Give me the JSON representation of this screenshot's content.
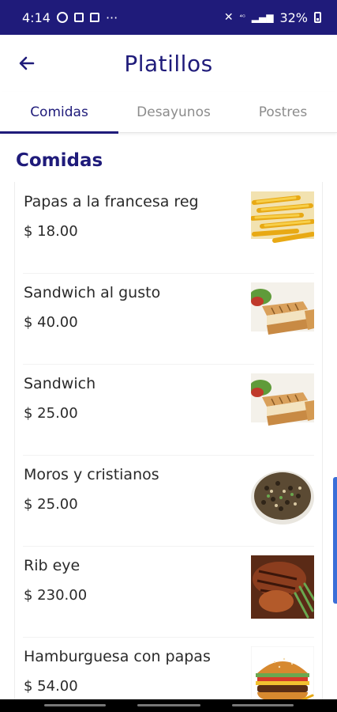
{
  "status_bar": {
    "time": "4:14",
    "battery": "32%",
    "overflow": "···",
    "icons": [
      "whatsapp-icon",
      "image-icon",
      "message-icon",
      "mute-icon",
      "lte-icon",
      "signal-icon",
      "battery-icon"
    ]
  },
  "header": {
    "title": "Platillos",
    "back_icon": "arrow-left-icon"
  },
  "tabs": [
    {
      "label": "Comidas",
      "active": true
    },
    {
      "label": "Desayunos",
      "active": false
    },
    {
      "label": "Postres",
      "active": false
    }
  ],
  "section": {
    "title": "Comidas"
  },
  "items": [
    {
      "name": "Papas a la francesa reg",
      "price": "$ 18.00",
      "image": "french-fries-image"
    },
    {
      "name": "Sandwich al gusto",
      "price": "$ 40.00",
      "image": "sandwich-image"
    },
    {
      "name": "Sandwich",
      "price": "$ 25.00",
      "image": "sandwich-image"
    },
    {
      "name": "Moros y cristianos",
      "price": "$ 25.00",
      "image": "rice-and-beans-image"
    },
    {
      "name": "Rib eye",
      "price": "$ 230.00",
      "image": "steak-image"
    },
    {
      "name": "Hamburguesa con papas",
      "price": "$ 54.00",
      "image": "burger-image"
    }
  ],
  "colors": {
    "primary": "#1f1b7a",
    "tab_inactive": "#8c8c8c",
    "scroll_indicator": "#3b6fd8"
  }
}
